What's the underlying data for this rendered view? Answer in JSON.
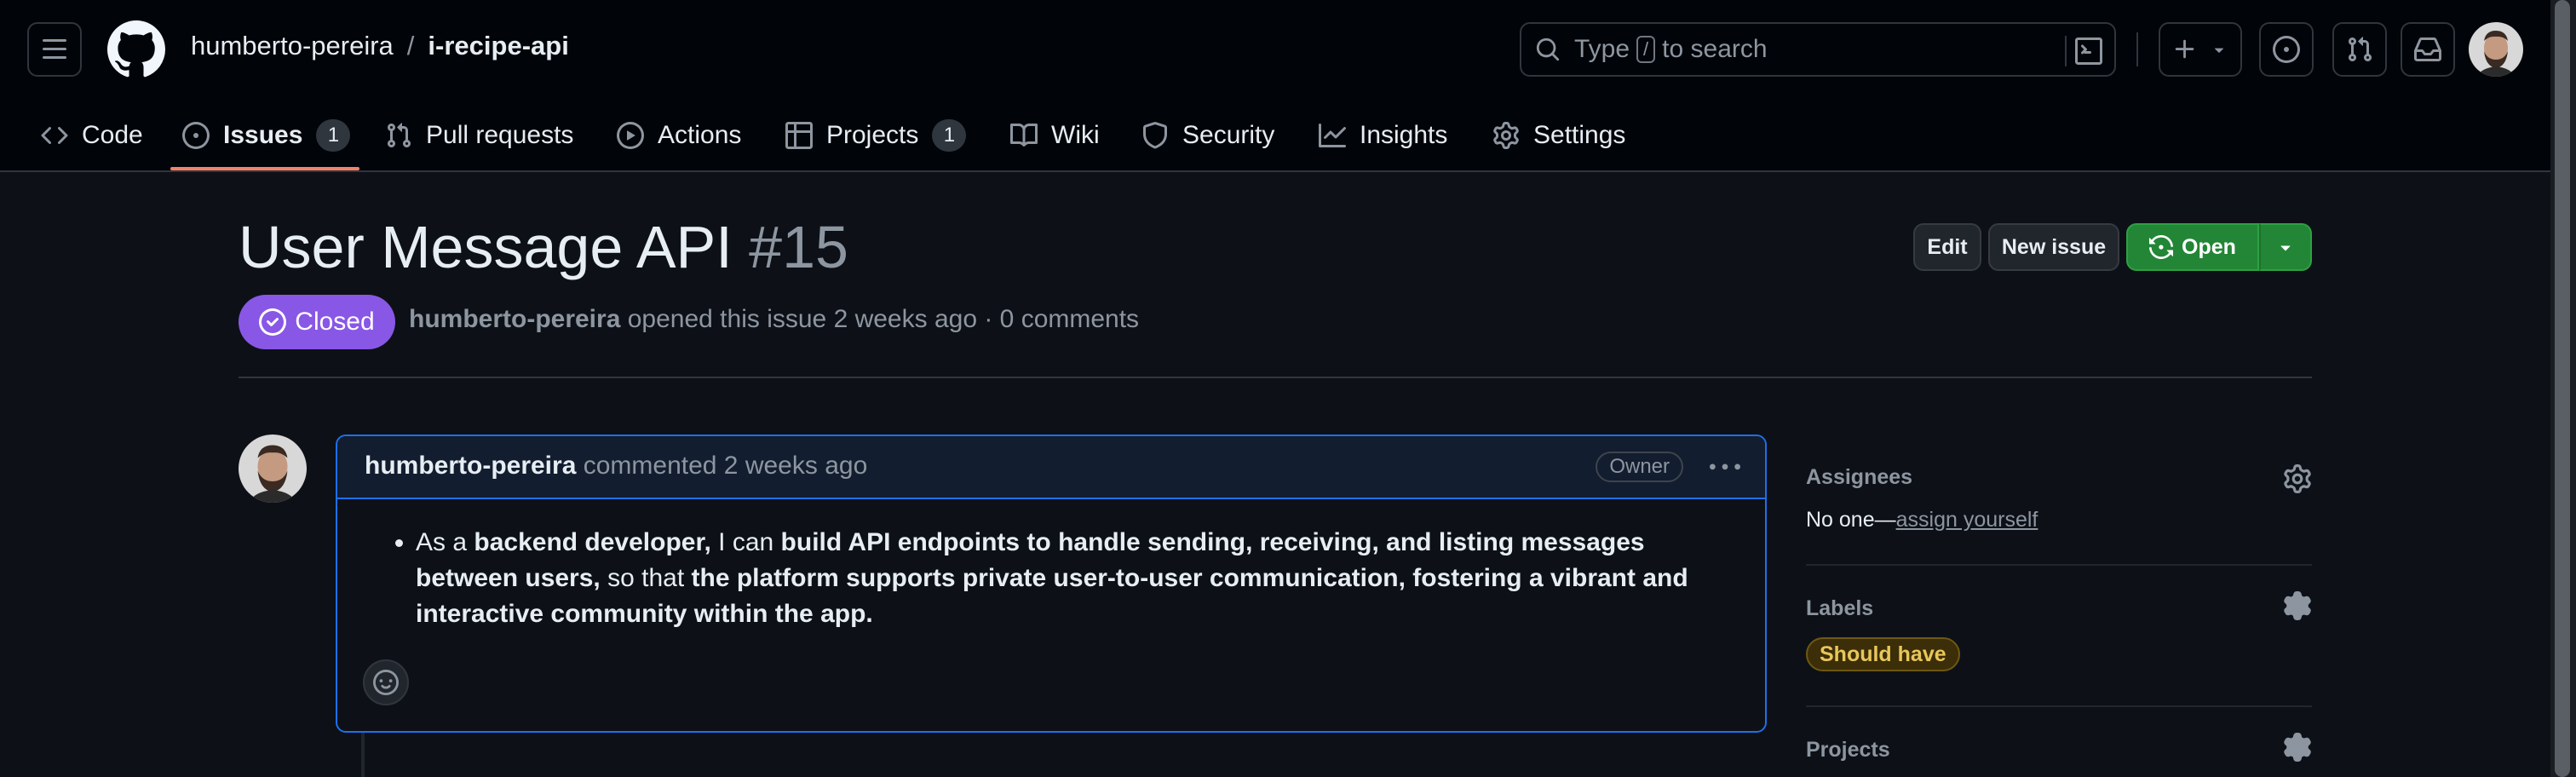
{
  "header": {
    "owner": "humberto-pereira",
    "separator": "/",
    "repo": "i-recipe-api",
    "search_prefix": "Type",
    "search_key": "/",
    "search_suffix": "to search"
  },
  "repo_nav": {
    "tabs": [
      {
        "label": "Code",
        "icon": "code-icon"
      },
      {
        "label": "Issues",
        "icon": "issue-opened-icon",
        "count": "1"
      },
      {
        "label": "Pull requests",
        "icon": "git-pull-request-icon"
      },
      {
        "label": "Actions",
        "icon": "play-icon"
      },
      {
        "label": "Projects",
        "icon": "table-icon",
        "count": "1"
      },
      {
        "label": "Wiki",
        "icon": "book-icon"
      },
      {
        "label": "Security",
        "icon": "shield-icon"
      },
      {
        "label": "Insights",
        "icon": "graph-icon"
      },
      {
        "label": "Settings",
        "icon": "gear-icon"
      }
    ],
    "selected": "Issues"
  },
  "issue": {
    "title": "User Message API",
    "number": "#15",
    "state": "Closed",
    "author": "humberto-pereira",
    "meta": "opened this issue 2 weeks ago · 0 comments",
    "buttons": {
      "edit": "Edit",
      "new_issue": "New issue",
      "reopen": "Open"
    }
  },
  "comment": {
    "author": "humberto-pereira",
    "action": "commented 2 weeks ago",
    "badge": "Owner",
    "body": {
      "p1": "As a ",
      "b1": "backend developer,",
      "p2": " I can ",
      "b2": "build API endpoints to handle sending, receiving, and listing messages between users,",
      "p3": " so that ",
      "b3": "the platform supports private user-to-user communication, fostering a vibrant and interactive community within the app."
    }
  },
  "sidebar": {
    "assignees": {
      "heading": "Assignees",
      "value_prefix": "No one—",
      "assign_link": "assign yourself"
    },
    "labels": {
      "heading": "Labels",
      "items": [
        {
          "name": "Should have",
          "color": "#e8c65a"
        }
      ]
    },
    "projects": {
      "heading": "Projects"
    }
  },
  "colors": {
    "background": "#0d1117",
    "header_bg": "#010409",
    "closed_badge": "#8957e5",
    "primary_button": "#238636",
    "active_tab_underline": "#f78166",
    "comment_border": "#1f6feb"
  }
}
